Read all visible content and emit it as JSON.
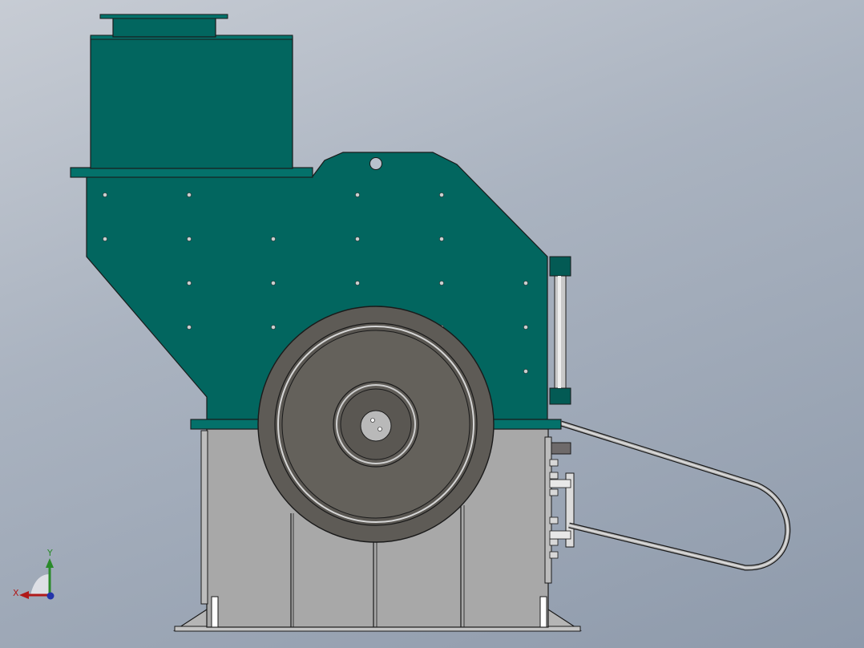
{
  "viewport": {
    "background_top": "#c7ccd4",
    "background_bottom": "#8e9aab"
  },
  "model": {
    "housing_color": "#02665f",
    "base_color": "#a7a7a7",
    "flywheel_color": "#5e5b56",
    "edge_color": "#1a1a1a"
  },
  "triad": {
    "x_label": "X",
    "y_label": "Y",
    "x_color": "#b01a1a",
    "y_color": "#2a8a2a",
    "z_color": "#2233aa"
  }
}
